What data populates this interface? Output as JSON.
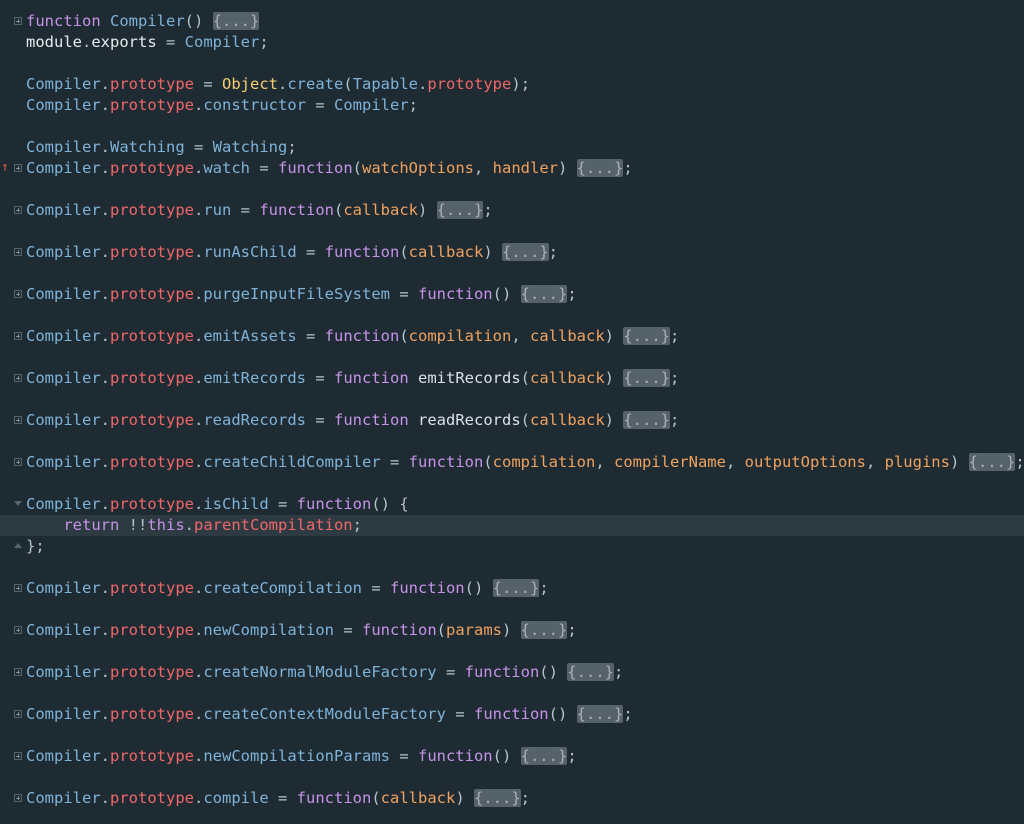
{
  "colors": {
    "background": "#1e2b33",
    "current_line": "#2d3a41",
    "keyword": "#c693e8",
    "identifier": "#7fb3d8",
    "property": "#f0676a",
    "parameter": "#f0a25f",
    "object": "#f3cf72",
    "fold_placeholder_bg": "#55626a",
    "bookmark_marker": "#e05a3a"
  },
  "lines": [
    {
      "gutter": "fold-plus",
      "tokens": [
        [
          "kw",
          "function"
        ],
        [
          "pun",
          " "
        ],
        [
          "id",
          "Compiler"
        ],
        [
          "pun",
          "() "
        ],
        [
          "fold",
          "{...}"
        ]
      ]
    },
    {
      "gutter": "",
      "tokens": [
        [
          "plain",
          "module"
        ],
        [
          "pun",
          "."
        ],
        [
          "plain",
          "exports"
        ],
        [
          "pun",
          " = "
        ],
        [
          "id",
          "Compiler"
        ],
        [
          "pun",
          ";"
        ]
      ]
    },
    {
      "gutter": "",
      "tokens": []
    },
    {
      "gutter": "",
      "tokens": [
        [
          "id",
          "Compiler"
        ],
        [
          "pun",
          "."
        ],
        [
          "prop",
          "prototype"
        ],
        [
          "pun",
          " = "
        ],
        [
          "obj",
          "Object"
        ],
        [
          "pun",
          "."
        ],
        [
          "meth",
          "create"
        ],
        [
          "pun",
          "("
        ],
        [
          "id",
          "Tapable"
        ],
        [
          "pun",
          "."
        ],
        [
          "prop",
          "prototype"
        ],
        [
          "pun",
          ");"
        ]
      ]
    },
    {
      "gutter": "",
      "tokens": [
        [
          "id",
          "Compiler"
        ],
        [
          "pun",
          "."
        ],
        [
          "prop",
          "prototype"
        ],
        [
          "pun",
          "."
        ],
        [
          "meth",
          "constructor"
        ],
        [
          "pun",
          " = "
        ],
        [
          "id",
          "Compiler"
        ],
        [
          "pun",
          ";"
        ]
      ]
    },
    {
      "gutter": "",
      "tokens": []
    },
    {
      "gutter": "",
      "tokens": [
        [
          "id",
          "Compiler"
        ],
        [
          "pun",
          "."
        ],
        [
          "meth",
          "Watching"
        ],
        [
          "pun",
          " = "
        ],
        [
          "id",
          "Watching"
        ],
        [
          "pun",
          ";"
        ]
      ]
    },
    {
      "gutter": "fold-plus",
      "marker": true,
      "tokens": [
        [
          "id",
          "Compiler"
        ],
        [
          "pun",
          "."
        ],
        [
          "prop",
          "prototype"
        ],
        [
          "pun",
          "."
        ],
        [
          "meth",
          "watch"
        ],
        [
          "pun",
          " = "
        ],
        [
          "kw",
          "function"
        ],
        [
          "pun",
          "("
        ],
        [
          "param",
          "watchOptions"
        ],
        [
          "pun",
          ", "
        ],
        [
          "param",
          "handler"
        ],
        [
          "pun",
          ") "
        ],
        [
          "fold",
          "{...}"
        ],
        [
          "pun",
          ";"
        ]
      ]
    },
    {
      "gutter": "",
      "tokens": []
    },
    {
      "gutter": "fold-plus",
      "tokens": [
        [
          "id",
          "Compiler"
        ],
        [
          "pun",
          "."
        ],
        [
          "prop",
          "prototype"
        ],
        [
          "pun",
          "."
        ],
        [
          "meth",
          "run"
        ],
        [
          "pun",
          " = "
        ],
        [
          "kw",
          "function"
        ],
        [
          "pun",
          "("
        ],
        [
          "param",
          "callback"
        ],
        [
          "pun",
          ") "
        ],
        [
          "fold",
          "{...}"
        ],
        [
          "pun",
          ";"
        ]
      ]
    },
    {
      "gutter": "",
      "tokens": []
    },
    {
      "gutter": "fold-plus",
      "tokens": [
        [
          "id",
          "Compiler"
        ],
        [
          "pun",
          "."
        ],
        [
          "prop",
          "prototype"
        ],
        [
          "pun",
          "."
        ],
        [
          "meth",
          "runAsChild"
        ],
        [
          "pun",
          " = "
        ],
        [
          "kw",
          "function"
        ],
        [
          "pun",
          "("
        ],
        [
          "param",
          "callback"
        ],
        [
          "pun",
          ") "
        ],
        [
          "fold",
          "{...}"
        ],
        [
          "pun",
          ";"
        ]
      ]
    },
    {
      "gutter": "",
      "tokens": []
    },
    {
      "gutter": "fold-plus",
      "tokens": [
        [
          "id",
          "Compiler"
        ],
        [
          "pun",
          "."
        ],
        [
          "prop",
          "prototype"
        ],
        [
          "pun",
          "."
        ],
        [
          "meth",
          "purgeInputFileSystem"
        ],
        [
          "pun",
          " = "
        ],
        [
          "kw",
          "function"
        ],
        [
          "pun",
          "() "
        ],
        [
          "fold",
          "{...}"
        ],
        [
          "pun",
          ";"
        ]
      ]
    },
    {
      "gutter": "",
      "tokens": []
    },
    {
      "gutter": "fold-plus",
      "tokens": [
        [
          "id",
          "Compiler"
        ],
        [
          "pun",
          "."
        ],
        [
          "prop",
          "prototype"
        ],
        [
          "pun",
          "."
        ],
        [
          "meth",
          "emitAssets"
        ],
        [
          "pun",
          " = "
        ],
        [
          "kw",
          "function"
        ],
        [
          "pun",
          "("
        ],
        [
          "param",
          "compilation"
        ],
        [
          "pun",
          ", "
        ],
        [
          "param",
          "callback"
        ],
        [
          "pun",
          ") "
        ],
        [
          "fold",
          "{...}"
        ],
        [
          "pun",
          ";"
        ]
      ]
    },
    {
      "gutter": "",
      "tokens": []
    },
    {
      "gutter": "fold-plus",
      "tokens": [
        [
          "id",
          "Compiler"
        ],
        [
          "pun",
          "."
        ],
        [
          "prop",
          "prototype"
        ],
        [
          "pun",
          "."
        ],
        [
          "meth",
          "emitRecords"
        ],
        [
          "pun",
          " = "
        ],
        [
          "kw",
          "function"
        ],
        [
          "pun",
          " "
        ],
        [
          "fn",
          "emitRecords"
        ],
        [
          "pun",
          "("
        ],
        [
          "param",
          "callback"
        ],
        [
          "pun",
          ") "
        ],
        [
          "fold",
          "{...}"
        ],
        [
          "pun",
          ";"
        ]
      ]
    },
    {
      "gutter": "",
      "tokens": []
    },
    {
      "gutter": "fold-plus",
      "tokens": [
        [
          "id",
          "Compiler"
        ],
        [
          "pun",
          "."
        ],
        [
          "prop",
          "prototype"
        ],
        [
          "pun",
          "."
        ],
        [
          "meth",
          "readRecords"
        ],
        [
          "pun",
          " = "
        ],
        [
          "kw",
          "function"
        ],
        [
          "pun",
          " "
        ],
        [
          "fn",
          "readRecords"
        ],
        [
          "pun",
          "("
        ],
        [
          "param",
          "callback"
        ],
        [
          "pun",
          ") "
        ],
        [
          "fold",
          "{...}"
        ],
        [
          "pun",
          ";"
        ]
      ]
    },
    {
      "gutter": "",
      "tokens": []
    },
    {
      "gutter": "fold-plus",
      "tokens": [
        [
          "id",
          "Compiler"
        ],
        [
          "pun",
          "."
        ],
        [
          "prop",
          "prototype"
        ],
        [
          "pun",
          "."
        ],
        [
          "meth",
          "createChildCompiler"
        ],
        [
          "pun",
          " = "
        ],
        [
          "kw",
          "function"
        ],
        [
          "pun",
          "("
        ],
        [
          "param",
          "compilation"
        ],
        [
          "pun",
          ", "
        ],
        [
          "param",
          "compilerName"
        ],
        [
          "pun",
          ", "
        ],
        [
          "param",
          "outputOptions"
        ],
        [
          "pun",
          ", "
        ],
        [
          "param",
          "plugins"
        ],
        [
          "pun",
          ") "
        ],
        [
          "fold",
          "{...}"
        ],
        [
          "pun",
          ";"
        ]
      ]
    },
    {
      "gutter": "",
      "tokens": []
    },
    {
      "gutter": "fold-open",
      "tokens": [
        [
          "id",
          "Compiler"
        ],
        [
          "pun",
          "."
        ],
        [
          "prop",
          "prototype"
        ],
        [
          "pun",
          "."
        ],
        [
          "meth",
          "isChild"
        ],
        [
          "pun",
          " = "
        ],
        [
          "kw",
          "function"
        ],
        [
          "pun",
          "() {"
        ]
      ]
    },
    {
      "gutter": "",
      "current": true,
      "tokens": [
        [
          "pun",
          "    "
        ],
        [
          "kw",
          "return"
        ],
        [
          "pun",
          " !!"
        ],
        [
          "kw",
          "this"
        ],
        [
          "pun",
          "."
        ],
        [
          "prop",
          "parentCompilation"
        ],
        [
          "pun",
          ";"
        ]
      ]
    },
    {
      "gutter": "fold-close",
      "tokens": [
        [
          "pun",
          "};"
        ]
      ]
    },
    {
      "gutter": "",
      "tokens": []
    },
    {
      "gutter": "fold-plus",
      "tokens": [
        [
          "id",
          "Compiler"
        ],
        [
          "pun",
          "."
        ],
        [
          "prop",
          "prototype"
        ],
        [
          "pun",
          "."
        ],
        [
          "meth",
          "createCompilation"
        ],
        [
          "pun",
          " = "
        ],
        [
          "kw",
          "function"
        ],
        [
          "pun",
          "() "
        ],
        [
          "fold",
          "{...}"
        ],
        [
          "pun",
          ";"
        ]
      ]
    },
    {
      "gutter": "",
      "tokens": []
    },
    {
      "gutter": "fold-plus",
      "tokens": [
        [
          "id",
          "Compiler"
        ],
        [
          "pun",
          "."
        ],
        [
          "prop",
          "prototype"
        ],
        [
          "pun",
          "."
        ],
        [
          "meth",
          "newCompilation"
        ],
        [
          "pun",
          " = "
        ],
        [
          "kw",
          "function"
        ],
        [
          "pun",
          "("
        ],
        [
          "param",
          "params"
        ],
        [
          "pun",
          ") "
        ],
        [
          "fold",
          "{...}"
        ],
        [
          "pun",
          ";"
        ]
      ]
    },
    {
      "gutter": "",
      "tokens": []
    },
    {
      "gutter": "fold-plus",
      "tokens": [
        [
          "id",
          "Compiler"
        ],
        [
          "pun",
          "."
        ],
        [
          "prop",
          "prototype"
        ],
        [
          "pun",
          "."
        ],
        [
          "meth",
          "createNormalModuleFactory"
        ],
        [
          "pun",
          " = "
        ],
        [
          "kw",
          "function"
        ],
        [
          "pun",
          "() "
        ],
        [
          "fold",
          "{...}"
        ],
        [
          "pun",
          ";"
        ]
      ]
    },
    {
      "gutter": "",
      "tokens": []
    },
    {
      "gutter": "fold-plus",
      "tokens": [
        [
          "id",
          "Compiler"
        ],
        [
          "pun",
          "."
        ],
        [
          "prop",
          "prototype"
        ],
        [
          "pun",
          "."
        ],
        [
          "meth",
          "createContextModuleFactory"
        ],
        [
          "pun",
          " = "
        ],
        [
          "kw",
          "function"
        ],
        [
          "pun",
          "() "
        ],
        [
          "fold",
          "{...}"
        ],
        [
          "pun",
          ";"
        ]
      ]
    },
    {
      "gutter": "",
      "tokens": []
    },
    {
      "gutter": "fold-plus",
      "tokens": [
        [
          "id",
          "Compiler"
        ],
        [
          "pun",
          "."
        ],
        [
          "prop",
          "prototype"
        ],
        [
          "pun",
          "."
        ],
        [
          "meth",
          "newCompilationParams"
        ],
        [
          "pun",
          " = "
        ],
        [
          "kw",
          "function"
        ],
        [
          "pun",
          "() "
        ],
        [
          "fold",
          "{...}"
        ],
        [
          "pun",
          ";"
        ]
      ]
    },
    {
      "gutter": "",
      "tokens": []
    },
    {
      "gutter": "fold-plus",
      "tokens": [
        [
          "id",
          "Compiler"
        ],
        [
          "pun",
          "."
        ],
        [
          "prop",
          "prototype"
        ],
        [
          "pun",
          "."
        ],
        [
          "meth",
          "compile"
        ],
        [
          "pun",
          " = "
        ],
        [
          "kw",
          "function"
        ],
        [
          "pun",
          "("
        ],
        [
          "param",
          "callback"
        ],
        [
          "pun",
          ") "
        ],
        [
          "fold",
          "{...}"
        ],
        [
          "pun",
          ";"
        ]
      ]
    }
  ]
}
